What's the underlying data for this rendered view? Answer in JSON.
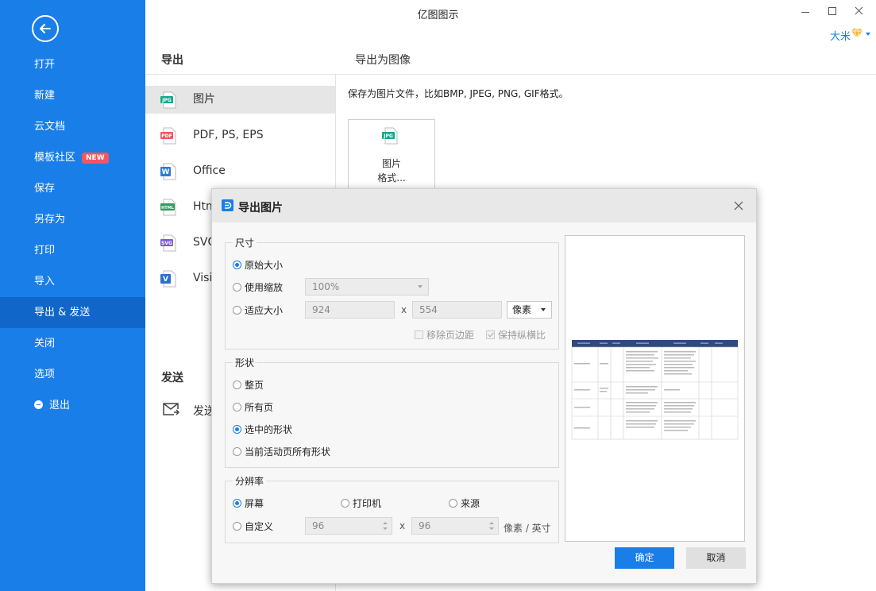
{
  "app": {
    "title": "亿图图示"
  },
  "user": {
    "name": "大米"
  },
  "sidebar": {
    "items": [
      {
        "label": "打开"
      },
      {
        "label": "新建"
      },
      {
        "label": "云文档"
      },
      {
        "label": "模板社区",
        "badge": "NEW"
      },
      {
        "label": "保存"
      },
      {
        "label": "另存为"
      },
      {
        "label": "打印"
      },
      {
        "label": "导入"
      },
      {
        "label": "导出 & 发送",
        "active": true
      },
      {
        "label": "关闭"
      },
      {
        "label": "选项"
      },
      {
        "label": "退出"
      }
    ]
  },
  "export": {
    "heading": "导出",
    "type_heading": "导出为图像",
    "formats": [
      {
        "label": "图片",
        "icon": "JPG",
        "color": "#1aa88c"
      },
      {
        "label": "PDF, PS, EPS",
        "icon": "PDF",
        "color": "#f0575f"
      },
      {
        "label": "Office",
        "icon": "W",
        "color": "#2b7cd3"
      },
      {
        "label": "Htm",
        "icon": "HTML",
        "color": "#2e9b5f"
      },
      {
        "label": "SVG",
        "icon": "SVG",
        "color": "#7d5bd6"
      },
      {
        "label": "Visio",
        "icon": "V",
        "color": "#2b6fd3"
      }
    ],
    "description": "保存为图片文件，比如BMP, JPEG, PNG, GIF格式。",
    "card": {
      "icon": "JPG",
      "label": "图片\n格式..."
    }
  },
  "send": {
    "heading": "发送",
    "item": "发送"
  },
  "dialog": {
    "title": "导出图片",
    "size": {
      "legend": "尺寸",
      "original": "原始大小",
      "scale": "使用缩放",
      "scale_value": "100%",
      "fit": "适应大小",
      "width": "924",
      "height": "554",
      "times": "x",
      "unit": "像素",
      "remove_margin": "移除页边距",
      "keep_ratio": "保持纵横比"
    },
    "shape": {
      "legend": "形状",
      "whole_page": "整页",
      "all_pages": "所有页",
      "selected": "选中的形状",
      "current_page": "当前活动页所有形状"
    },
    "resolution": {
      "legend": "分辨率",
      "screen": "屏幕",
      "printer": "打印机",
      "source": "来源",
      "custom": "自定义",
      "dpi_x": "96",
      "dpi_y": "96",
      "times": "x",
      "unit": "像素 / 英寸"
    },
    "ok": "确定",
    "cancel": "取消"
  },
  "colors": {
    "accent": "#1a7ee8",
    "sidebar": "#1a7ee8",
    "sidebar_active": "#1167c9",
    "preview_header": "#2f4a7c"
  }
}
